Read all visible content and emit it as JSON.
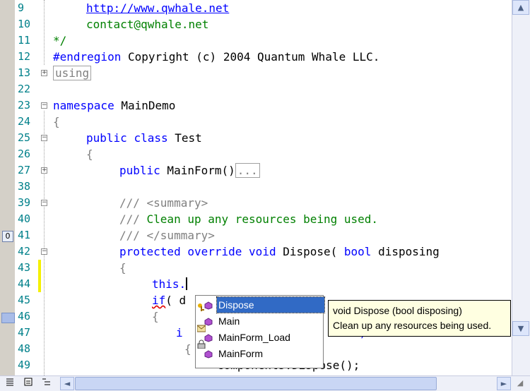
{
  "editor": {
    "gutter": {
      "line_numbers": [
        "9",
        "10",
        "11",
        "12",
        "13",
        "22",
        "23",
        "24",
        "25",
        "26",
        "27",
        "38",
        "39",
        "40",
        "41",
        "42",
        "43",
        "44",
        "45",
        "46",
        "47",
        "48",
        "49"
      ],
      "bookmark_label": "0"
    },
    "code": {
      "l9_link": "http://www.qwhale.net",
      "l10_email": "contact@qwhale.net",
      "l11_text": "*/",
      "l12_kw": "#endregion",
      "l12_text": " Copyright (c) 2004 Quantum Whale LLC.",
      "l13_collapsed": "using",
      "l23_kw": "namespace",
      "l23_text": " MainDemo",
      "l24_text": "{",
      "l25_kw1": "public",
      "l25_kw2": "class",
      "l25_text": " Test",
      "l26_text": "{",
      "l27_kw": "public",
      "l27_text": " MainForm()",
      "l27_collapsed": "...",
      "l39_prefix": "/// ",
      "l39_tag": "<summary>",
      "l40_prefix": "/// ",
      "l40_comment": "Clean up any resources being used.",
      "l41_prefix": "/// ",
      "l41_tag": "</summary>",
      "l42_kw1": "protected",
      "l42_kw2": "override",
      "l42_kw3": "void",
      "l42_text1": " Dispose( ",
      "l42_kw4": "bool",
      "l42_text2": " disposing",
      "l43_text": "{",
      "l44_text": "this.",
      "l45_kw": "if",
      "l45_text": "( d",
      "l46_text": "{",
      "l47_text1": "i",
      "l47_text2": "null)",
      "l48_text": "{",
      "l49_text": "components.Dispose();"
    }
  },
  "completion": {
    "items": [
      {
        "label": "Dispose",
        "selected": true,
        "icon": "method-icon"
      },
      {
        "label": "Main",
        "selected": false,
        "icon": "method-icon"
      },
      {
        "label": "MainForm_Load",
        "selected": false,
        "icon": "method-icon"
      },
      {
        "label": "MainForm",
        "selected": false,
        "icon": "method-icon"
      }
    ]
  },
  "tooltip": {
    "signature": "void Dispose (bool disposing)",
    "summary": "Clean up any resources being used."
  },
  "colors": {
    "keyword": "#0000ff",
    "comment": "#008000",
    "line_number": "#00808a",
    "selection": "#316ac5",
    "tooltip_bg": "#ffffe1",
    "change_bar": "#f4f000"
  },
  "scrollbar": {
    "up_icon": "▲",
    "down_icon": "▼",
    "left_icon": "◄",
    "right_icon": "►",
    "resize_icon": "◢"
  },
  "view_buttons": [
    "normal-view-icon",
    "page-view-icon",
    "outline-view-icon"
  ]
}
